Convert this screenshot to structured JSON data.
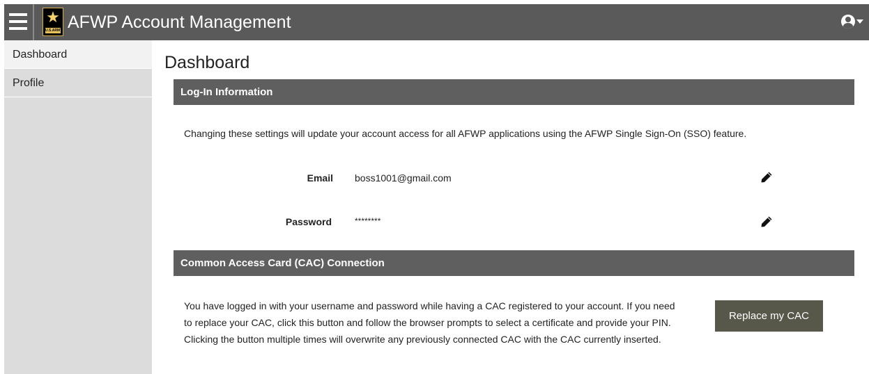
{
  "header": {
    "app_title": "AFWP Account Management",
    "logo_text": "U.S.ARMY",
    "icons": {
      "menu": "hamburger-icon",
      "logo": "army-star-logo",
      "user": "user-circle-icon",
      "caret": "caret-down-icon"
    }
  },
  "sidebar": {
    "items": [
      {
        "label": "Dashboard",
        "active": true
      },
      {
        "label": "Profile",
        "active": false
      }
    ]
  },
  "main": {
    "page_title": "Dashboard",
    "login_section": {
      "title": "Log-In Information",
      "description": "Changing these settings will update your account access for all AFWP applications using the AFWP Single Sign-On (SSO) feature.",
      "fields": [
        {
          "label": "Email",
          "value": "boss1001@gmail.com",
          "icon": "pencil-icon"
        },
        {
          "label": "Password",
          "value": "********",
          "icon": "pencil-icon"
        }
      ]
    },
    "cac_section": {
      "title": "Common Access Card (CAC) Connection",
      "description": "You have logged in with your username and password while having a CAC registered to your account. If you need to replace your CAC, click this button and follow the browser prompts to select a certificate and provide your PIN. Clicking the button multiple times will overwrite any previously connected CAC with the CAC currently inserted.",
      "button_label": "Replace my CAC"
    }
  },
  "colors": {
    "header_bg": "#5a5a5a",
    "section_header_bg": "#5f5f5f",
    "sidebar_bg": "#dcdcdc",
    "button_bg": "#57574a"
  }
}
